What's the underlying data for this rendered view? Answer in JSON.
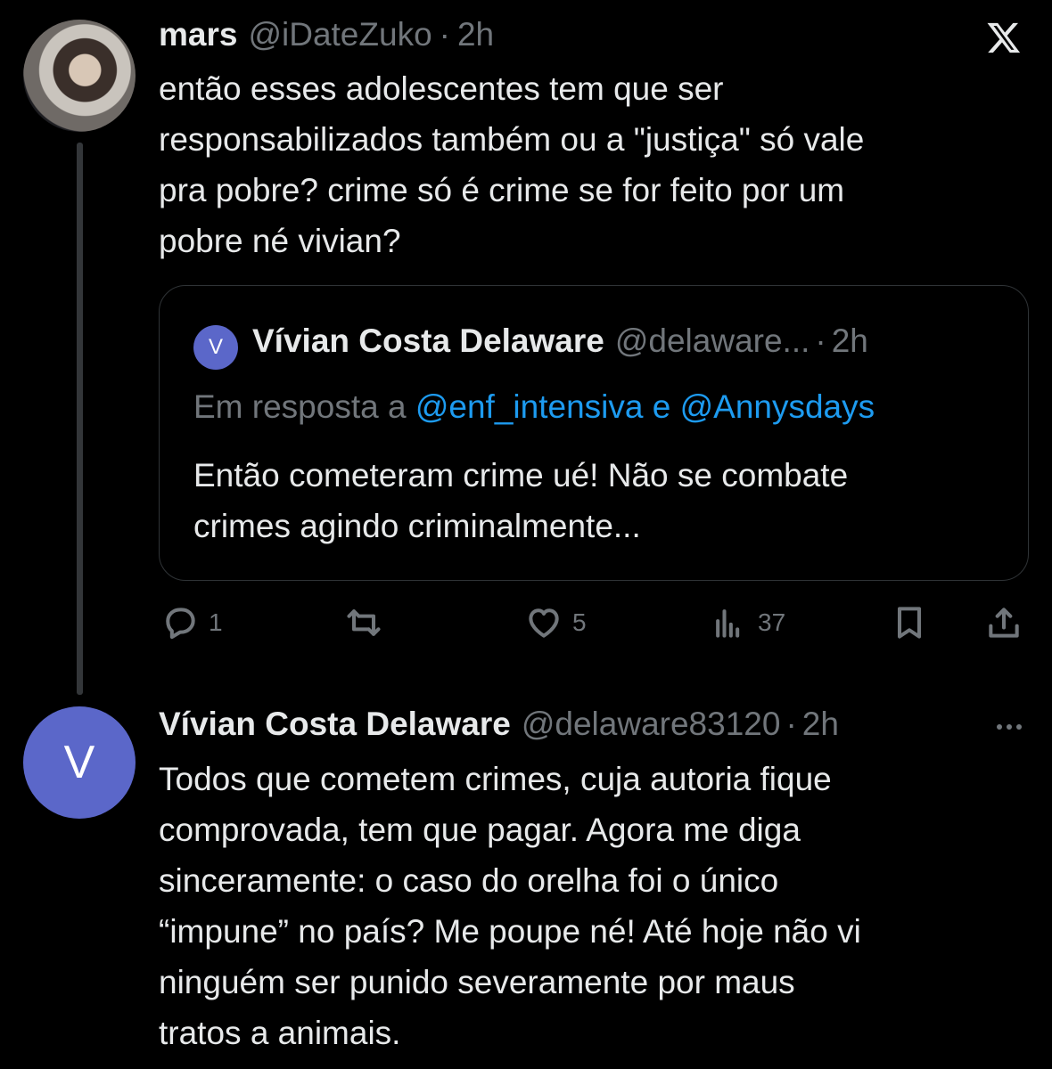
{
  "tweet1": {
    "name": "mars",
    "handle": "@iDateZuko",
    "separator": "·",
    "time": "2h",
    "text": "então esses adolescentes tem que ser\nresponsabilizados também ou a \"justiça\" só vale\npra pobre? crime só é crime se for feito por um\npobre né vivian?"
  },
  "quote": {
    "avatar_letter": "V",
    "name": "Vívian Costa Delaware",
    "handle": "@delaware...",
    "separator": "·",
    "time": "2h",
    "reply_prefix": "Em resposta a",
    "reply_targets": "@enf_intensiva e @Annysdays",
    "text": "Então cometeram crime ué! Não se combate\ncrimes agindo criminalmente..."
  },
  "actions": {
    "replies": "1",
    "likes": "5",
    "views": "37"
  },
  "tweet2": {
    "avatar_letter": "V",
    "name": "Vívian Costa Delaware",
    "handle": "@delaware83120",
    "separator": "·",
    "time": "2h",
    "text": "Todos que cometem crimes, cuja autoria fique\ncomprovada, tem que pagar. Agora me diga\nsinceramente: o caso do orelha foi o único\n“impune” no país? Me poupe né! Até hoje não vi\nninguém ser punido severamente por maus\ntratos a animais."
  },
  "icons": [
    "x-logo-icon",
    "reply-icon",
    "retweet-icon",
    "like-icon",
    "views-icon",
    "bookmark-icon",
    "share-icon",
    "more-icon"
  ],
  "colors": {
    "background": "#000000",
    "text": "#e7e9ea",
    "muted": "#71767b",
    "link": "#1d9bf0",
    "avatar": "#5b67c9"
  }
}
